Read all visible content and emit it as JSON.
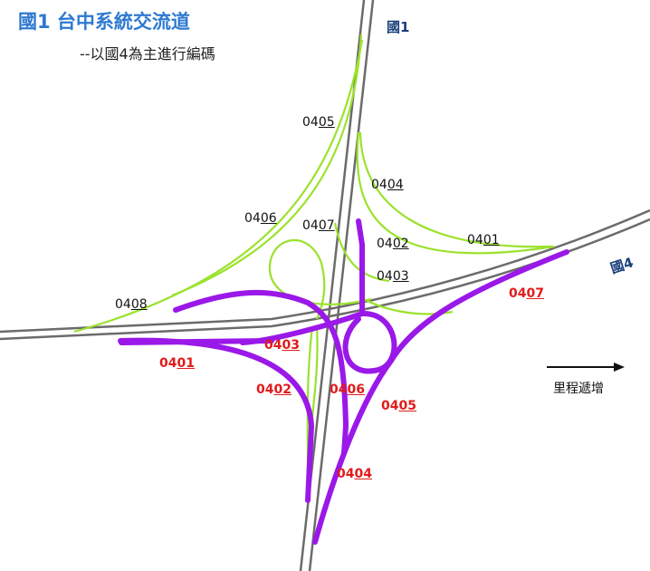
{
  "title": "國1 台中系統交流道",
  "subtitle": "--以國4為主進行編碼",
  "highways": {
    "north_south": "國1",
    "east_west": "國4"
  },
  "direction_label": "里程遞增",
  "colors": {
    "highway": "#6b6b6b",
    "existing_ramp": "#9be22c",
    "highlighted_ramp": "#9a18e8",
    "label_red": "#e11b1b",
    "title_blue": "#2e79d0"
  },
  "ramp_labels_green": [
    {
      "prefix": "04",
      "suffix": "05"
    },
    {
      "prefix": "04",
      "suffix": "04"
    },
    {
      "prefix": "04",
      "suffix": "06"
    },
    {
      "prefix": "04",
      "suffix": "07"
    },
    {
      "prefix": "04",
      "suffix": "02"
    },
    {
      "prefix": "04",
      "suffix": "01"
    },
    {
      "prefix": "04",
      "suffix": "03"
    },
    {
      "prefix": "04",
      "suffix": "08"
    }
  ],
  "ramp_labels_purple": [
    {
      "prefix": "04",
      "suffix": "07"
    },
    {
      "prefix": "04",
      "suffix": "03"
    },
    {
      "prefix": "04",
      "suffix": "01"
    },
    {
      "prefix": "04",
      "suffix": "02"
    },
    {
      "prefix": "04",
      "suffix": "06"
    },
    {
      "prefix": "04",
      "suffix": "05"
    },
    {
      "prefix": "04",
      "suffix": "04"
    }
  ]
}
